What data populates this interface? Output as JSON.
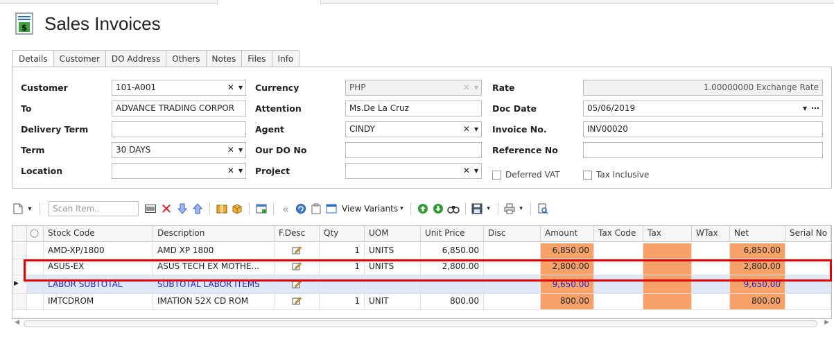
{
  "app": {
    "title": "Sales Invoices"
  },
  "tabs": [
    "Details",
    "Customer",
    "DO Address",
    "Others",
    "Notes",
    "Files",
    "Info"
  ],
  "form": {
    "customer": {
      "label": "Customer",
      "value": "101-A001"
    },
    "to": {
      "label": "To",
      "value": "ADVANCE TRADING CORPOR"
    },
    "delivery_term": {
      "label": "Delivery Term",
      "value": ""
    },
    "term": {
      "label": "Term",
      "value": "30 DAYS"
    },
    "location": {
      "label": "Location",
      "value": ""
    },
    "currency": {
      "label": "Currency",
      "value": "PHP"
    },
    "attention": {
      "label": "Attention",
      "value": "Ms.De La Cruz"
    },
    "agent": {
      "label": "Agent",
      "value": "CINDY"
    },
    "our_do_no": {
      "label": "Our DO No",
      "value": ""
    },
    "project": {
      "label": "Project",
      "value": ""
    },
    "rate": {
      "label": "Rate",
      "value": "1.00000000 Exchange Rate"
    },
    "doc_date": {
      "label": "Doc Date",
      "value": "05/06/2019"
    },
    "invoice_no": {
      "label": "Invoice No.",
      "value": "INV00020"
    },
    "reference_no": {
      "label": "Reference No",
      "value": ""
    },
    "deferred_vat": {
      "label": "Deferred VAT"
    },
    "tax_inclusive": {
      "label": "Tax Inclusive"
    }
  },
  "toolbar": {
    "scan_placeholder": "Scan Item..",
    "view_variants": "View Variants"
  },
  "grid": {
    "columns": [
      "Stock Code",
      "Description",
      "F.Desc",
      "Qty",
      "UOM",
      "Unit Price",
      "Disc",
      "Amount",
      "Tax Code",
      "Tax",
      "WTax",
      "Net",
      "Serial No"
    ],
    "rows": [
      {
        "stock_code": "AMD-XP/1800",
        "description": "AMD XP 1800",
        "qty": "1",
        "uom": "UNITS",
        "unit_price": "6,850.00",
        "amount": "6,850.00",
        "net": "6,850.00"
      },
      {
        "stock_code": "ASUS-EX",
        "description": "ASUS TECH EX MOTHE...",
        "qty": "1",
        "uom": "UNITS",
        "unit_price": "2,800.00",
        "amount": "2,800.00",
        "net": "2,800.00"
      },
      {
        "stock_code": "LABOR SUBTOTAL",
        "description": "SUBTOTAL LABOR ITEMS",
        "qty": "",
        "uom": "",
        "unit_price": "",
        "amount": "9,650.00",
        "net": "9,650.00"
      },
      {
        "stock_code": "IMTCDROM",
        "description": "IMATION 52X CD ROM",
        "qty": "1",
        "uom": "UNIT",
        "unit_price": "800.00",
        "amount": "800.00",
        "net": "800.00"
      }
    ]
  },
  "colors": {
    "amount_fill": "#f8a26a",
    "subtotal_text": "#2222cc",
    "highlight_border": "#e00000"
  }
}
